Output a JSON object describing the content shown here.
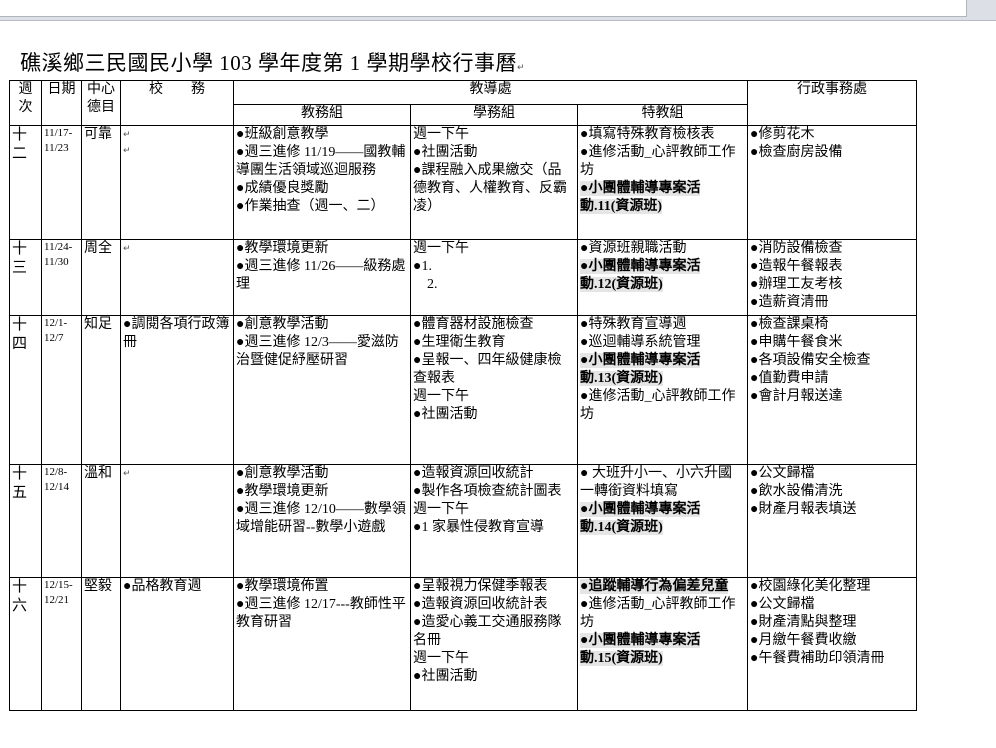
{
  "title": "礁溪鄉三民國民小學 103 學年度第 1 學期學校行事曆",
  "headers": {
    "week": "週次",
    "date": "日期",
    "virtue": "中心德目",
    "school": "校　　務",
    "teaching_office": "教導處",
    "academic": "教務組",
    "student_affairs": "學務組",
    "special_ed": "特教組",
    "admin": "行政事務處"
  },
  "rows": [
    {
      "week": "十二",
      "date": "11/17-11/23",
      "virtue": "可靠",
      "school": [],
      "academic": [
        "●班級創意教學",
        "●週三進修 11/19——國教輔導團生活領域巡迴服務",
        "●成績優良獎勵",
        "●作業抽查（週一、二）"
      ],
      "student": [
        "週一下午",
        "●社團活動",
        "●課程融入成果繳交（品德教育、人權教育、反霸凌）"
      ],
      "special": [
        "●填寫特殊教育檢核表",
        "●進修活動_心評教師工作坊",
        "●小團體輔導專案活動.11(資源班)"
      ],
      "admin": [
        "●修剪花木",
        "●檢查廚房設備"
      ]
    },
    {
      "week": "十三",
      "date": "11/24-11/30",
      "virtue": "周全",
      "school": [],
      "academic": [
        "●教學環境更新",
        "●週三進修 11/26——級務處理"
      ],
      "student": [
        "週一下午",
        "●1.",
        "2."
      ],
      "special": [
        "●資源班親職活動",
        "●小團體輔導專案活動.12(資源班)"
      ],
      "admin": [
        "●消防設備檢查",
        "●造報午餐報表",
        "●辦理工友考核",
        "●造薪資清冊"
      ]
    },
    {
      "week": "十四",
      "date": "12/1-12/7",
      "virtue": "知足",
      "school": [
        "●調閱各項行政簿冊"
      ],
      "academic": [
        "●創意教學活動",
        "●週三進修 12/3——愛滋防治暨健促紓壓研習"
      ],
      "student": [
        "●體育器材設施檢查",
        "●生理衛生教育",
        "●呈報一、四年級健康檢查報表",
        "週一下午",
        "●社團活動"
      ],
      "special": [
        "●特殊教育宣導週",
        "●巡迴輔導系統管理",
        "●小團體輔導專案活動.13(資源班)",
        "●進修活動_心評教師工作坊"
      ],
      "admin": [
        "●檢查課桌椅",
        "●申購午餐食米",
        "●各項設備安全檢查",
        "●值勤費申請",
        "●會計月報送達"
      ]
    },
    {
      "week": "十五",
      "date": "12/8-12/14",
      "virtue": "溫和",
      "school": [],
      "academic": [
        "●創意教學活動",
        "●教學環境更新",
        "●週三進修 12/10——數學領域增能研習--數學小遊戲"
      ],
      "student": [
        "●造報資源回收統計",
        "●製作各項檢查統計圖表",
        "週一下午",
        "●1 家暴性侵教育宣導"
      ],
      "special": [
        "● 大班升小一、小六升國一轉銜資料填寫",
        "●小團體輔導專案活動.14(資源班)"
      ],
      "admin": [
        "●公文歸檔",
        "●飲水設備清洗",
        "●財產月報表填送"
      ]
    },
    {
      "week": "十六",
      "date": "12/15-12/21",
      "virtue": "堅毅",
      "school": [
        "●品格教育週"
      ],
      "academic": [
        "●教學環境佈置",
        "●週三進修 12/17---教師性平教育研習"
      ],
      "student": [
        "●呈報視力保健季報表",
        "●造報資源回收統計表",
        "●造愛心義工交通服務隊名冊",
        "週一下午",
        "●社團活動"
      ],
      "special": [
        "●追蹤輔導行為偏差兒童",
        "●進修活動_心評教師工作坊",
        "●小團體輔導專案活動.15(資源班)"
      ],
      "admin": [
        "●校園綠化美化整理",
        "●公文歸檔",
        "●財產清點與整理",
        "●月繳午餐費收繳",
        "●午餐費補助印領清冊"
      ]
    }
  ]
}
